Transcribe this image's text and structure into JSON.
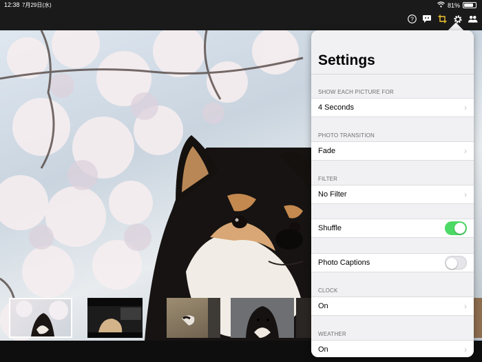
{
  "status_bar": {
    "time": "12:38",
    "date": "7月29日(水)",
    "battery": "81%",
    "battery_level": 0.81
  },
  "toolbar": {
    "icons": [
      "help-icon",
      "chat-icon",
      "crop-icon",
      "gear-icon",
      "people-icon"
    ],
    "accent": "#f2c62f"
  },
  "settings": {
    "title": "Settings",
    "sections": {
      "show_each_picture_for": {
        "label": "SHOW EACH PICTURE FOR",
        "value": "4 Seconds"
      },
      "photo_transition": {
        "label": "PHOTO TRANSITION",
        "value": "Fade"
      },
      "filter": {
        "label": "FILTER",
        "value": "No Filter"
      },
      "shuffle": {
        "label": "Shuffle",
        "on": true
      },
      "photo_captions": {
        "label": "Photo Captions",
        "on": false
      },
      "clock": {
        "label": "CLOCK",
        "value": "On"
      },
      "weather": {
        "label": "WEATHER",
        "value": "On"
      }
    }
  },
  "colors": {
    "toggle_on": "#4cd964",
    "toggle_off": "#e5e5ea",
    "chevron": "#c4c4c8"
  }
}
